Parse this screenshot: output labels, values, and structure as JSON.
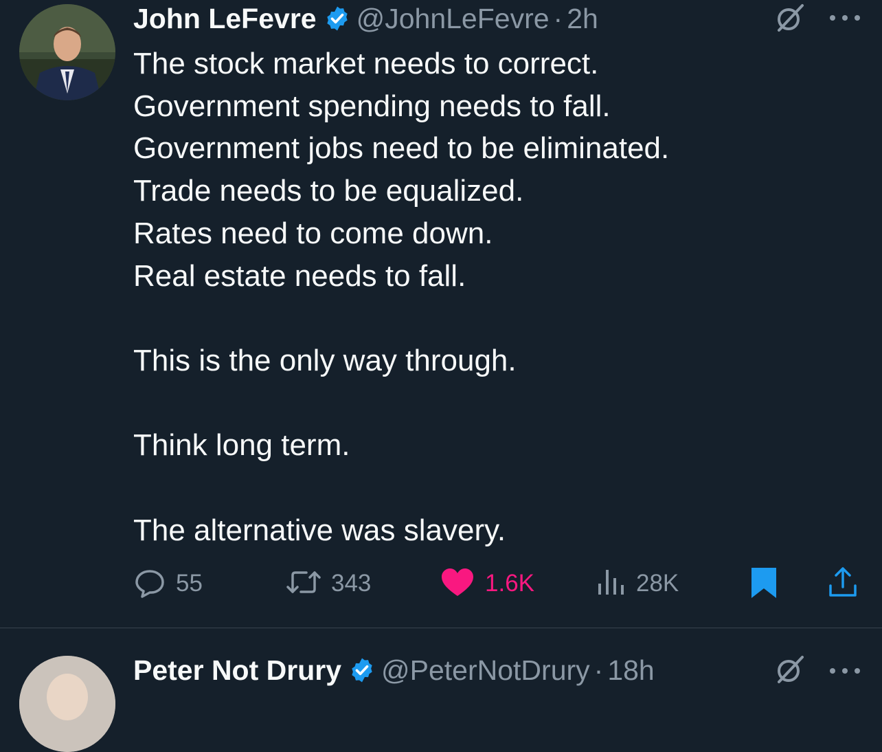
{
  "tweets": [
    {
      "name": "John LeFevre",
      "handle": "@JohnLeFevre",
      "separator": "·",
      "time": "2h",
      "lines": [
        "The stock market needs to correct.",
        "Government spending needs to fall.",
        "Government jobs need to be eliminated.",
        "Trade needs to be equalized.",
        "Rates need to come down.",
        "Real estate needs to fall.",
        "",
        "This is the only way through.",
        "",
        "Think long term.",
        "",
        "The alternative was slavery."
      ],
      "actions": {
        "replies": "55",
        "reposts": "343",
        "likes": "1.6K",
        "views": "28K"
      },
      "liked": true,
      "bookmarked": true
    },
    {
      "name": "Peter Not Drury",
      "handle": "@PeterNotDrury",
      "separator": "·",
      "time": "18h"
    }
  ],
  "icons": {
    "verified": "verified-badge-icon",
    "grok": "grok-icon",
    "more": "more-options-icon",
    "reply": "reply-icon",
    "repost": "repost-icon",
    "like": "heart-icon",
    "views": "views-icon",
    "bookmark": "bookmark-icon",
    "share": "share-icon"
  },
  "colors": {
    "background": "#15202b",
    "text": "#f7f9f9",
    "muted": "#8b98a5",
    "accent": "#1d9bf0",
    "like": "#f91880"
  }
}
